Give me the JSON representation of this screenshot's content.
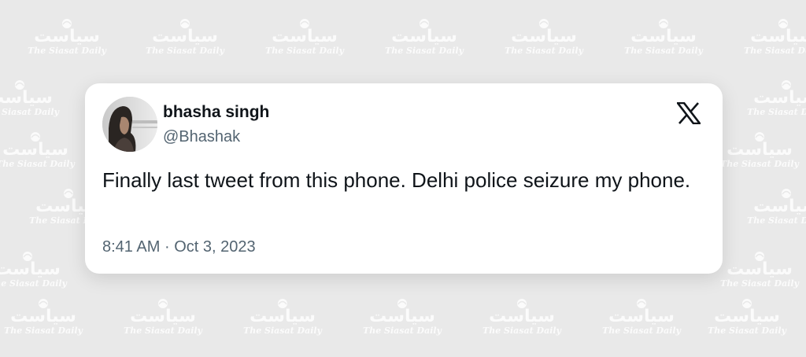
{
  "watermark": {
    "arabic": "سیاست",
    "latin": "The Siasat Daily"
  },
  "tweet": {
    "author_name": "bhasha singh",
    "author_handle": "@Bhashak",
    "text": "Finally last tweet from this phone. Delhi police seizure my phone.",
    "time": "8:41 AM",
    "separator": "·",
    "date": "Oct 3, 2023"
  },
  "icons": {
    "platform": "x-logo-icon",
    "avatar": "profile-photo"
  },
  "colors": {
    "background": "#e9e9e9",
    "card": "#ffffff",
    "text_primary": "#0f1419",
    "text_secondary": "#536471"
  }
}
